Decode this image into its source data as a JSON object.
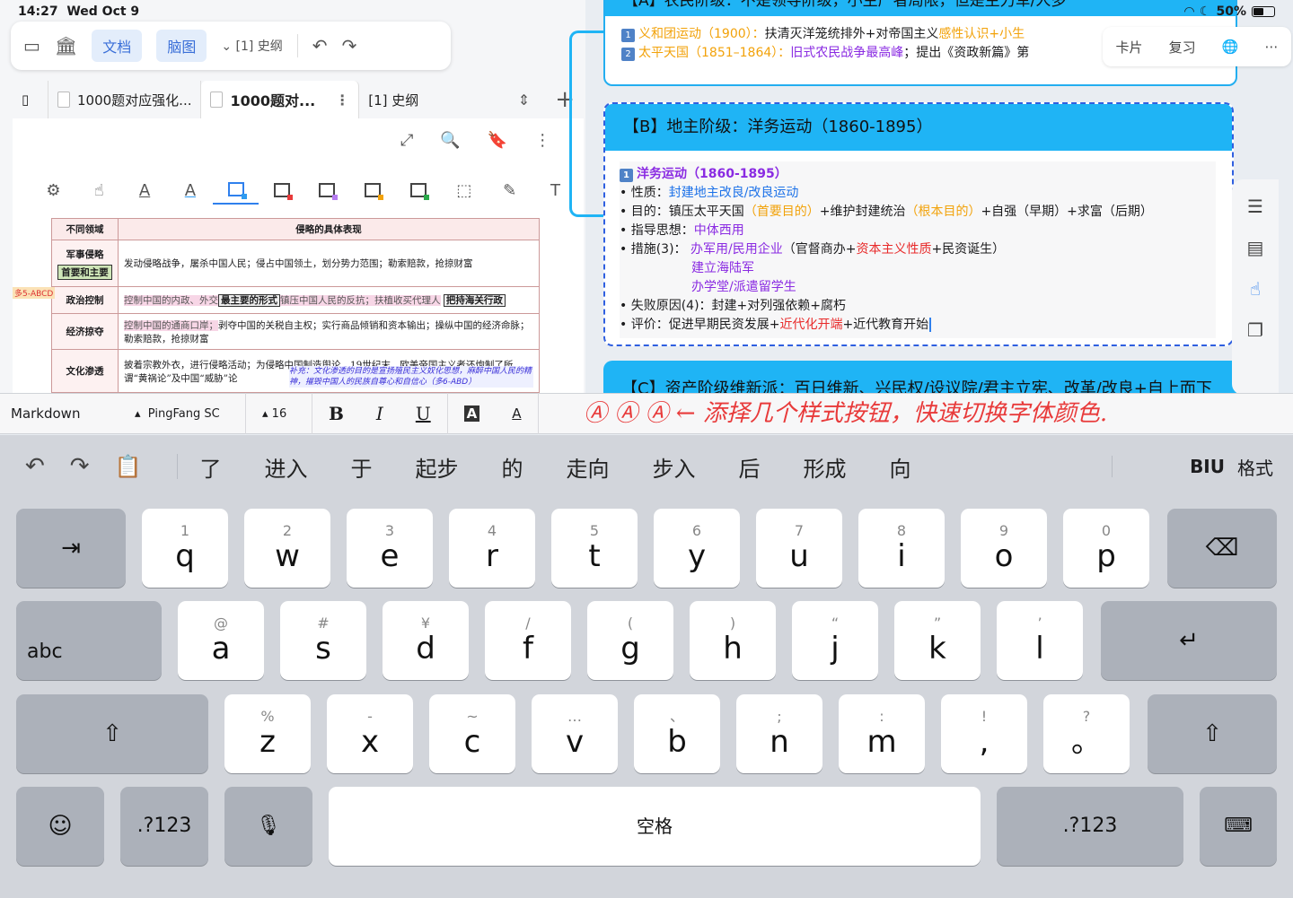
{
  "status": {
    "time": "14:27",
    "date": "Wed Oct 9",
    "battery": "50%"
  },
  "toolbar": {
    "doc_tab": "文档",
    "mindmap_tab": "脑图",
    "outline_label": "[1] 史纲"
  },
  "tabs": [
    {
      "label": "1000题对应强化..."
    },
    {
      "label": "1000题对..."
    },
    {
      "label": "[1] 史纲"
    }
  ],
  "doc_table": {
    "headers": [
      "不同领域",
      "侵略的具体表现"
    ],
    "rows": [
      {
        "cat": "军事侵略",
        "tag": "首要和主要",
        "text": "发动侵略战争，屠杀中国人民；侵占中国领土，划分势力范围；勒索赔款，抢掠财富"
      },
      {
        "cat": "政治控制",
        "pre": "控制中国的内政、外交",
        "tag": "最主要的形式",
        "mid": "镇压中国人民的反抗；扶植收买代理人",
        "tag2": "把持海关行政"
      },
      {
        "cat": "经济掠夺",
        "pre": "控制中国的通商口岸；",
        "text": "剥夺中国的关税自主权；实行商品倾销和资本输出；操纵中国的经济命脉；勒索赔款，抢掠财富"
      },
      {
        "cat": "文化渗透",
        "text": "披着宗教外衣，进行侵略活动；为侵略中国制造舆论，19世纪末，欧美帝国主义者还炮制了所谓“黄祸论”及中国“威胁”论"
      }
    ],
    "margin_note": "多5-ABCD",
    "hand_note": "补充：文化渗透的目的是宣扬殖民主义奴化思想，麻醉中国人民的精神，摧毁中国人的民族自尊心和自信心（多6-ABD）"
  },
  "cards": {
    "a_head": "【A】农民阶级：不是领导阶级，小生产者局限，但是主力军/人多",
    "a_line1": {
      "num": "1",
      "t1": "义和团运动（1900）：",
      "t2": "扶清灭洋笼统排外+对帝国主义",
      "t3": "感性认识",
      "t4": "+小生"
    },
    "a_line2": {
      "num": "2",
      "t1": "太平天国（1851–1864）：",
      "t2": "旧式农民战争最高峰",
      "t3": "；提出《资政新篇》第"
    },
    "b_head": "【B】地主阶级：洋务运动（1860-1895）",
    "b_title": {
      "num": "1",
      "text": "洋务运动（1860-1895）"
    },
    "b_nature": {
      "label": "• 性质：",
      "value": "封建地主改良/改良运动"
    },
    "b_purpose": {
      "label": "• 目的：镇压太平天国",
      "p1": "（首要目的）",
      "p2": "+维护封建统治",
      "p3": "（根本目的）",
      "p4": "+自强（早期）+求富（后期）"
    },
    "b_guide": {
      "label": "• 指导思想：",
      "value": "中体西用"
    },
    "b_measure": {
      "label": "• 措施(3)：",
      "m1": "办军用/民用企业",
      "m2": "（官督商办+",
      "m3": "资本主义性质",
      "m4": "+民资诞生）",
      "m5": "建立海陆军",
      "m6": "办学堂/派遣留学生"
    },
    "b_fail": {
      "label": "• 失败原因(4)：",
      "value": "封建+对列强依赖+腐朽"
    },
    "b_eval": {
      "label": "• 评价：促进早期民资发展+",
      "v1": "近代化开端",
      "v2": "+近代教育开始"
    },
    "c_head": "【C】资产阶级维新派：百日维新、兴民权/设议院/君主立宪、改革/改良+自上而下"
  },
  "right_tools": {
    "card": "卡片",
    "review": "复习"
  },
  "format_bar": {
    "mode": "Markdown",
    "font": "PingFang SC",
    "size": "16"
  },
  "annotation": "Ⓐ Ⓐ Ⓐ ← 添择几个样式按钮，快速切换字体颜色.",
  "candidates": [
    "了",
    "进入",
    "于",
    "起步",
    "的",
    "走向",
    "步入",
    "后",
    "形成",
    "向"
  ],
  "format_label": "格式",
  "biu": "BIU",
  "keys": {
    "row1": [
      {
        "sub": "1",
        "main": "q"
      },
      {
        "sub": "2",
        "main": "w"
      },
      {
        "sub": "3",
        "main": "e"
      },
      {
        "sub": "4",
        "main": "r"
      },
      {
        "sub": "5",
        "main": "t"
      },
      {
        "sub": "6",
        "main": "y"
      },
      {
        "sub": "7",
        "main": "u"
      },
      {
        "sub": "8",
        "main": "i"
      },
      {
        "sub": "9",
        "main": "o"
      },
      {
        "sub": "0",
        "main": "p"
      }
    ],
    "row2": [
      {
        "sub": "@",
        "main": "a"
      },
      {
        "sub": "#",
        "main": "s"
      },
      {
        "sub": "¥",
        "main": "d"
      },
      {
        "sub": "/",
        "main": "f"
      },
      {
        "sub": "(",
        "main": "g"
      },
      {
        "sub": ")",
        "main": "h"
      },
      {
        "sub": "“",
        "main": "j"
      },
      {
        "sub": "”",
        "main": "k"
      },
      {
        "sub": "’",
        "main": "l"
      }
    ],
    "row3": [
      {
        "sub": "%",
        "main": "z"
      },
      {
        "sub": "-",
        "main": "x"
      },
      {
        "sub": "~",
        "main": "c"
      },
      {
        "sub": "…",
        "main": "v"
      },
      {
        "sub": "、",
        "main": "b"
      },
      {
        "sub": ";",
        "main": "n"
      },
      {
        "sub": ":",
        "main": "m"
      },
      {
        "sub": "!",
        "main": ","
      },
      {
        "sub": "?",
        "main": "。"
      }
    ],
    "abc": "abc",
    "num": ".?123",
    "space": "空格"
  }
}
